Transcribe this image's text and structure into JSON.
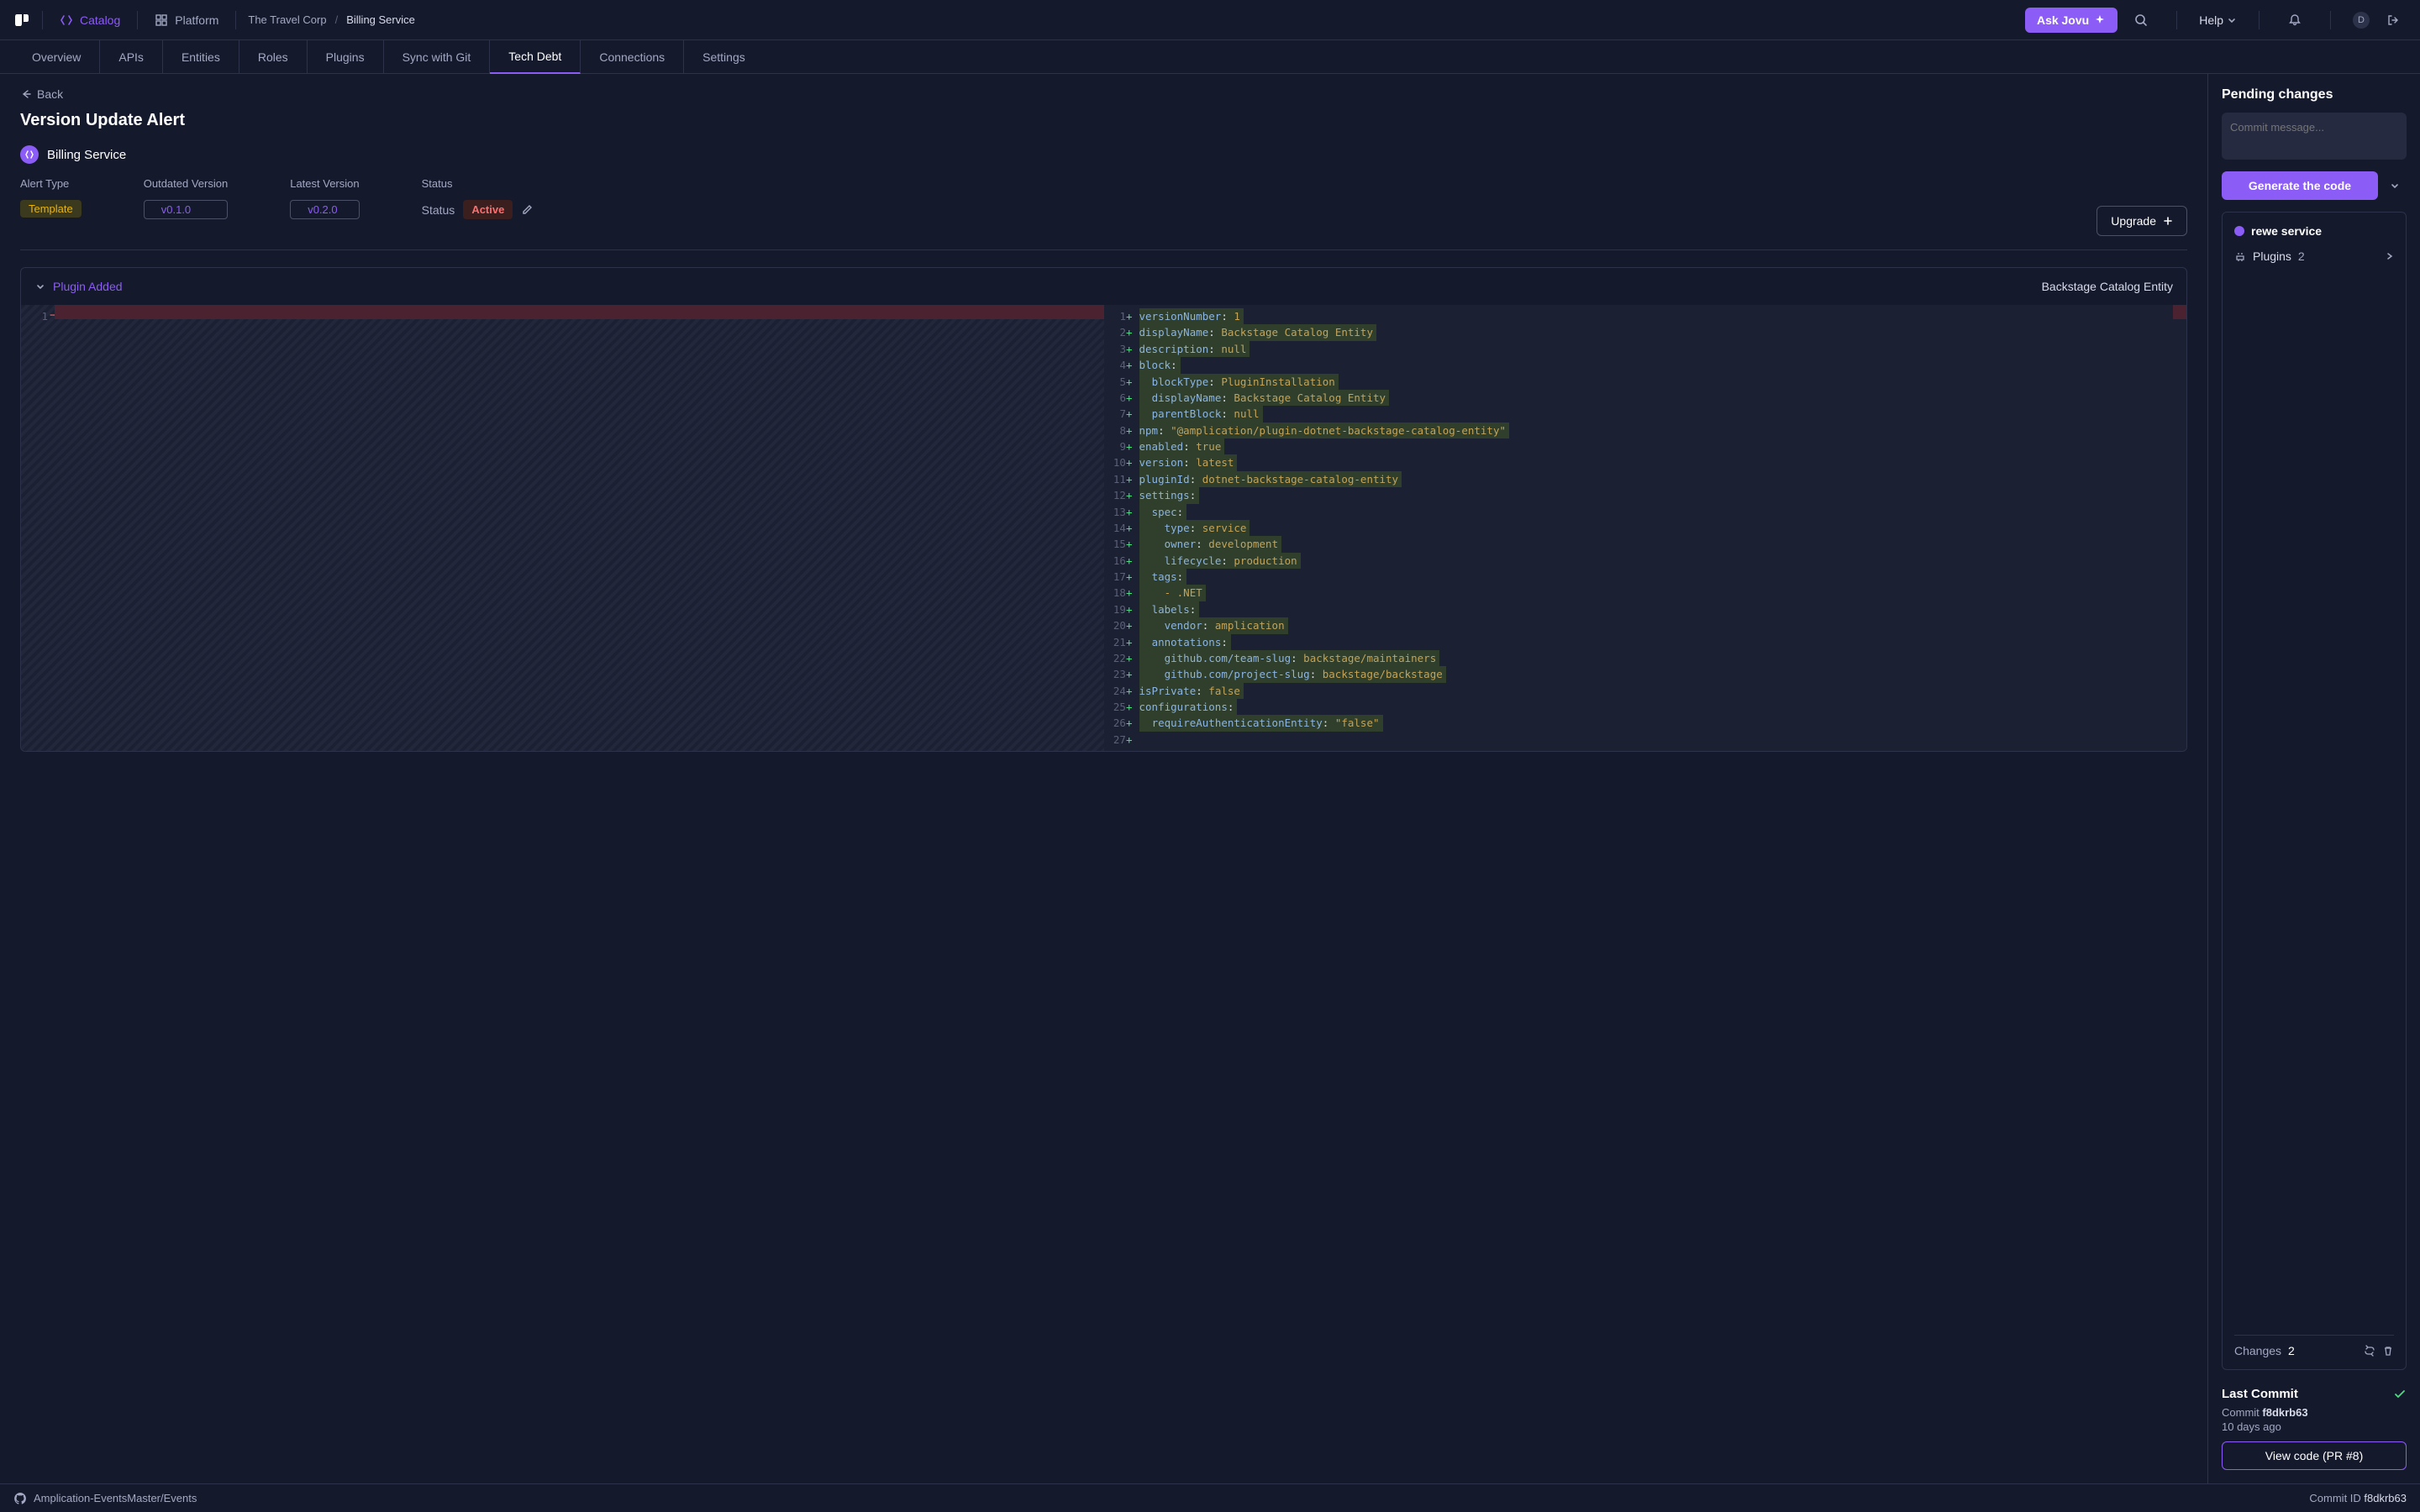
{
  "topbar": {
    "nav": {
      "catalog": "Catalog",
      "platform": "Platform"
    },
    "breadcrumb": {
      "org": "The Travel Corp",
      "service": "Billing Service"
    },
    "ask_label": "Ask Jovu",
    "help_label": "Help",
    "avatar_letter": "D"
  },
  "tabs": [
    "Overview",
    "APIs",
    "Entities",
    "Roles",
    "Plugins",
    "Sync with Git",
    "Tech Debt",
    "Connections",
    "Settings"
  ],
  "back_label": "Back",
  "page_title": "Version Update Alert",
  "service": {
    "name": "Billing Service"
  },
  "info": {
    "labels": {
      "alert_type": "Alert Type",
      "outdated": "Outdated Version",
      "latest": "Latest Version",
      "status": "Status"
    },
    "alert_type": "Template",
    "outdated": "v0.1.0",
    "latest": "v0.2.0",
    "status_label": "Status",
    "status_value": "Active",
    "upgrade_label": "Upgrade"
  },
  "diff": {
    "section_title": "Plugin Added",
    "right_label": "Backstage Catalog Entity",
    "left_line_no": "1",
    "code_lines": [
      {
        "n": 1,
        "text": "versionNumber: 1"
      },
      {
        "n": 2,
        "text": "displayName: Backstage Catalog Entity"
      },
      {
        "n": 3,
        "text": "description: null"
      },
      {
        "n": 4,
        "text": "block:"
      },
      {
        "n": 5,
        "text": "  blockType: PluginInstallation"
      },
      {
        "n": 6,
        "text": "  displayName: Backstage Catalog Entity"
      },
      {
        "n": 7,
        "text": "  parentBlock: null"
      },
      {
        "n": 8,
        "text": "npm: \"@amplication/plugin-dotnet-backstage-catalog-entity\""
      },
      {
        "n": 9,
        "text": "enabled: true"
      },
      {
        "n": 10,
        "text": "version: latest"
      },
      {
        "n": 11,
        "text": "pluginId: dotnet-backstage-catalog-entity"
      },
      {
        "n": 12,
        "text": "settings:"
      },
      {
        "n": 13,
        "text": "  spec:"
      },
      {
        "n": 14,
        "text": "    type: service"
      },
      {
        "n": 15,
        "text": "    owner: development"
      },
      {
        "n": 16,
        "text": "    lifecycle: production"
      },
      {
        "n": 17,
        "text": "  tags:"
      },
      {
        "n": 18,
        "text": "    - .NET"
      },
      {
        "n": 19,
        "text": "  labels:"
      },
      {
        "n": 20,
        "text": "    vendor: amplication"
      },
      {
        "n": 21,
        "text": "  annotations:"
      },
      {
        "n": 22,
        "text": "    github.com/team-slug: backstage/maintainers"
      },
      {
        "n": 23,
        "text": "    github.com/project-slug: backstage/backstage"
      },
      {
        "n": 24,
        "text": "isPrivate: false"
      },
      {
        "n": 25,
        "text": "configurations:"
      },
      {
        "n": 26,
        "text": "  requireAuthenticationEntity: \"false\""
      },
      {
        "n": 27,
        "text": ""
      }
    ]
  },
  "sidebar": {
    "title": "Pending changes",
    "commit_placeholder": "Commit message...",
    "generate_label": "Generate the code",
    "service_name": "rewe service",
    "plugins_label": "Plugins",
    "plugins_count": "2",
    "changes_label": "Changes",
    "changes_count": "2",
    "last_commit_title": "Last Commit",
    "commit_prefix": "Commit ",
    "commit_hash": "f8dkrb63",
    "commit_age": "10 days ago",
    "view_code_label": "View code (PR #8)"
  },
  "bottombar": {
    "repo": "Amplication-EventsMaster/Events",
    "commit_label": "Commit ID ",
    "commit_hash": "f8dkrb63"
  }
}
